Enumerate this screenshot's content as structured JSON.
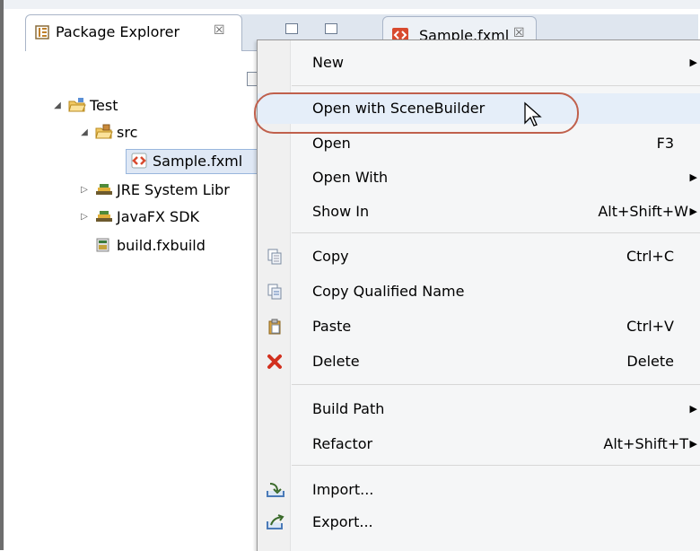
{
  "package_explorer": {
    "tab_label": "Package Explorer",
    "tab_close": "☒",
    "tree": [
      {
        "label": "Test",
        "icon": "project-folder-icon"
      },
      {
        "label": "src",
        "icon": "package-folder-icon"
      },
      {
        "label": "Sample.fxml",
        "icon": "fxml-file-icon"
      },
      {
        "label": "JRE System Libr",
        "icon": "library-icon"
      },
      {
        "label": "JavaFX SDK",
        "icon": "library-icon"
      },
      {
        "label": "build.fxbuild",
        "icon": "build-file-icon"
      }
    ]
  },
  "editor_tab": {
    "label": "Sample.fxml",
    "close": "☒"
  },
  "context_menu": {
    "items": [
      {
        "label": "New",
        "shortcut": "",
        "submenu": true
      },
      {
        "label": "Open with SceneBuilder",
        "shortcut": "",
        "submenu": false,
        "highlighted": true
      },
      {
        "label": "Open",
        "shortcut": "F3",
        "submenu": false
      },
      {
        "label": "Open With",
        "shortcut": "",
        "submenu": true
      },
      {
        "label": "Show In",
        "shortcut": "Alt+Shift+W",
        "submenu": true
      },
      {
        "label": "Copy",
        "shortcut": "Ctrl+C",
        "icon": "copy-icon"
      },
      {
        "label": "Copy Qualified Name",
        "shortcut": "",
        "icon": "copy-qualified-name-icon"
      },
      {
        "label": "Paste",
        "shortcut": "Ctrl+V",
        "icon": "paste-icon"
      },
      {
        "label": "Delete",
        "shortcut": "Delete",
        "icon": "delete-icon"
      },
      {
        "label": "Build Path",
        "shortcut": "",
        "submenu": true
      },
      {
        "label": "Refactor",
        "shortcut": "Alt+Shift+T",
        "submenu": true
      },
      {
        "label": "Import...",
        "shortcut": "",
        "icon": "import-icon"
      },
      {
        "label": "Export...",
        "shortcut": "",
        "icon": "export-icon"
      }
    ],
    "submenu_arrow": "▶"
  },
  "colors": {
    "highlight_ring": "#c0604c",
    "selection": "#dfe8f5"
  }
}
